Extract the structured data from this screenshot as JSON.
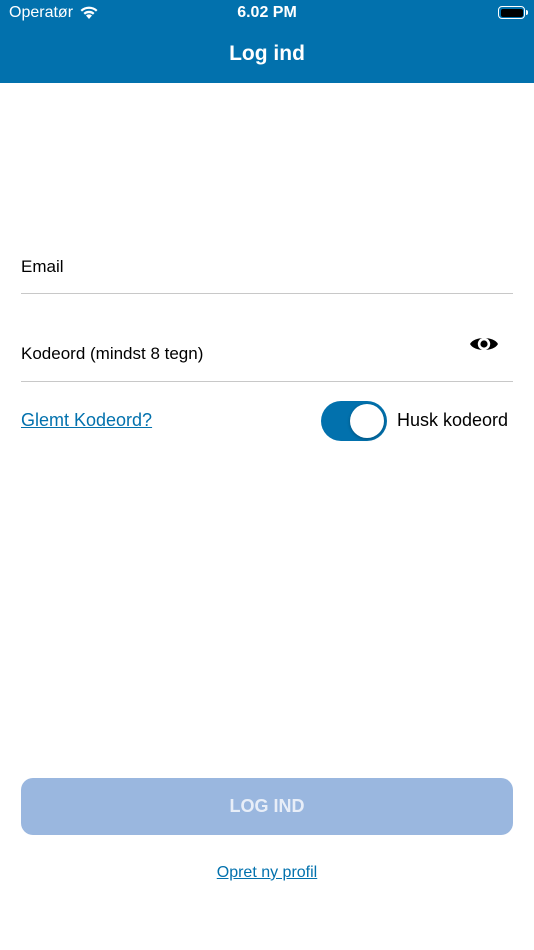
{
  "status_bar": {
    "carrier": "Operatør",
    "time": "6.02 PM"
  },
  "header": {
    "title": "Log ind",
    "background_color": "#0271ad"
  },
  "form": {
    "email": {
      "placeholder": "Email",
      "value": ""
    },
    "password": {
      "placeholder": "Kodeord (mindst 8 tegn)",
      "value": "",
      "visibility_icon": "eye-icon"
    },
    "forgot_password_label": "Glemt Kodeord?",
    "remember_password": {
      "label": "Husk kodeord",
      "enabled": true
    }
  },
  "actions": {
    "login_label": "LOG IND",
    "login_enabled": false,
    "create_profile_label": "Opret ny profil"
  },
  "colors": {
    "accent": "#0271ad",
    "disabled_button": "#9ab7df"
  }
}
